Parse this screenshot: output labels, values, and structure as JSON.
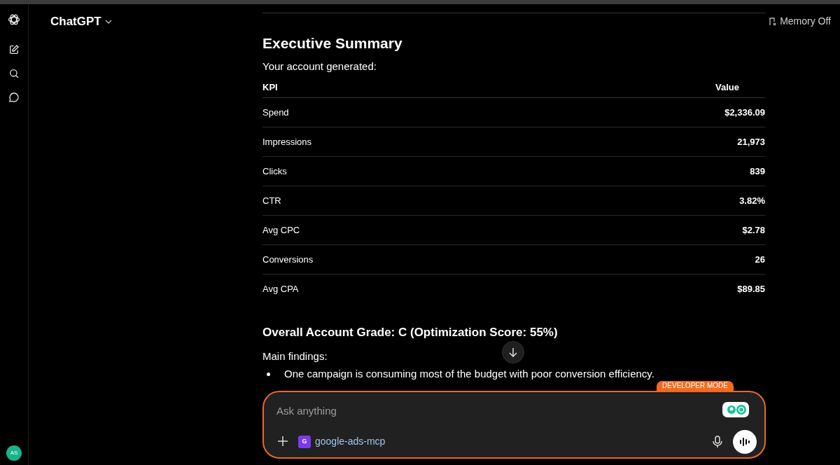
{
  "header": {
    "title": "ChatGPT",
    "memory": "Memory Off"
  },
  "user": {
    "initials": "AS"
  },
  "message": {
    "heading": "Executive Summary",
    "intro": "Your account generated:",
    "table": {
      "columns": [
        "KPI",
        "Value"
      ],
      "rows": [
        [
          "Spend",
          "$2,336.09"
        ],
        [
          "Impressions",
          "21,973"
        ],
        [
          "Clicks",
          "839"
        ],
        [
          "CTR",
          "3.82%"
        ],
        [
          "Avg CPC",
          "$2.78"
        ],
        [
          "Conversions",
          "26"
        ],
        [
          "Avg CPA",
          "$89.85"
        ]
      ]
    },
    "grade_heading": "Overall Account Grade: C (Optimization Score: 55%)",
    "findings_label": "Main findings:",
    "findings": [
      "One campaign is consuming most of the budget with poor conversion efficiency."
    ]
  },
  "composer": {
    "badge": "DEVELOPER MODE",
    "placeholder": "Ask anything",
    "tool": {
      "letter": "G",
      "name": "google-ads-mcp"
    }
  }
}
